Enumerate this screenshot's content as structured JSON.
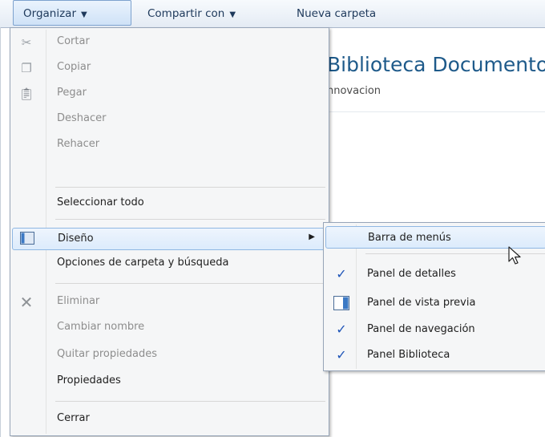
{
  "toolbar": {
    "organize_label": "Organizar",
    "share_label": "Compartir con",
    "new_folder_label": "Nueva carpeta"
  },
  "library": {
    "title": "Biblioteca Documento",
    "subtitle": "nnovacion"
  },
  "menu": {
    "items": [
      {
        "label": "Cortar",
        "icon": "scissors-icon",
        "enabled": false
      },
      {
        "label": "Copiar",
        "icon": "copy-icon",
        "enabled": false
      },
      {
        "label": "Pegar",
        "icon": "paste-icon",
        "enabled": false
      },
      {
        "label": "Deshacer",
        "enabled": false
      },
      {
        "label": "Rehacer",
        "enabled": false
      },
      {
        "label": "Seleccionar todo",
        "enabled": true
      },
      {
        "label": "Diseño",
        "icon": "layout-icon",
        "enabled": true,
        "submenu": true
      },
      {
        "label": "Opciones de carpeta y búsqueda",
        "enabled": true
      },
      {
        "label": "Eliminar",
        "icon": "delete-icon",
        "enabled": false
      },
      {
        "label": "Cambiar nombre",
        "enabled": false
      },
      {
        "label": "Quitar propiedades",
        "enabled": false
      },
      {
        "label": "Propiedades",
        "enabled": true
      },
      {
        "label": "Cerrar",
        "enabled": true
      }
    ]
  },
  "submenu": {
    "items": [
      {
        "label": "Barra de menús",
        "checked": false
      },
      {
        "label": "Panel de detalles",
        "checked": true
      },
      {
        "label": "Panel de vista previa",
        "checked": false,
        "icon": "preview-pane-icon"
      },
      {
        "label": "Panel de navegación",
        "checked": true
      },
      {
        "label": "Panel Biblioteca",
        "checked": true
      }
    ]
  },
  "colors": {
    "highlight_border": "#8fb7e3",
    "title_blue": "#1e5a8a",
    "check_blue": "#1f55b8"
  }
}
